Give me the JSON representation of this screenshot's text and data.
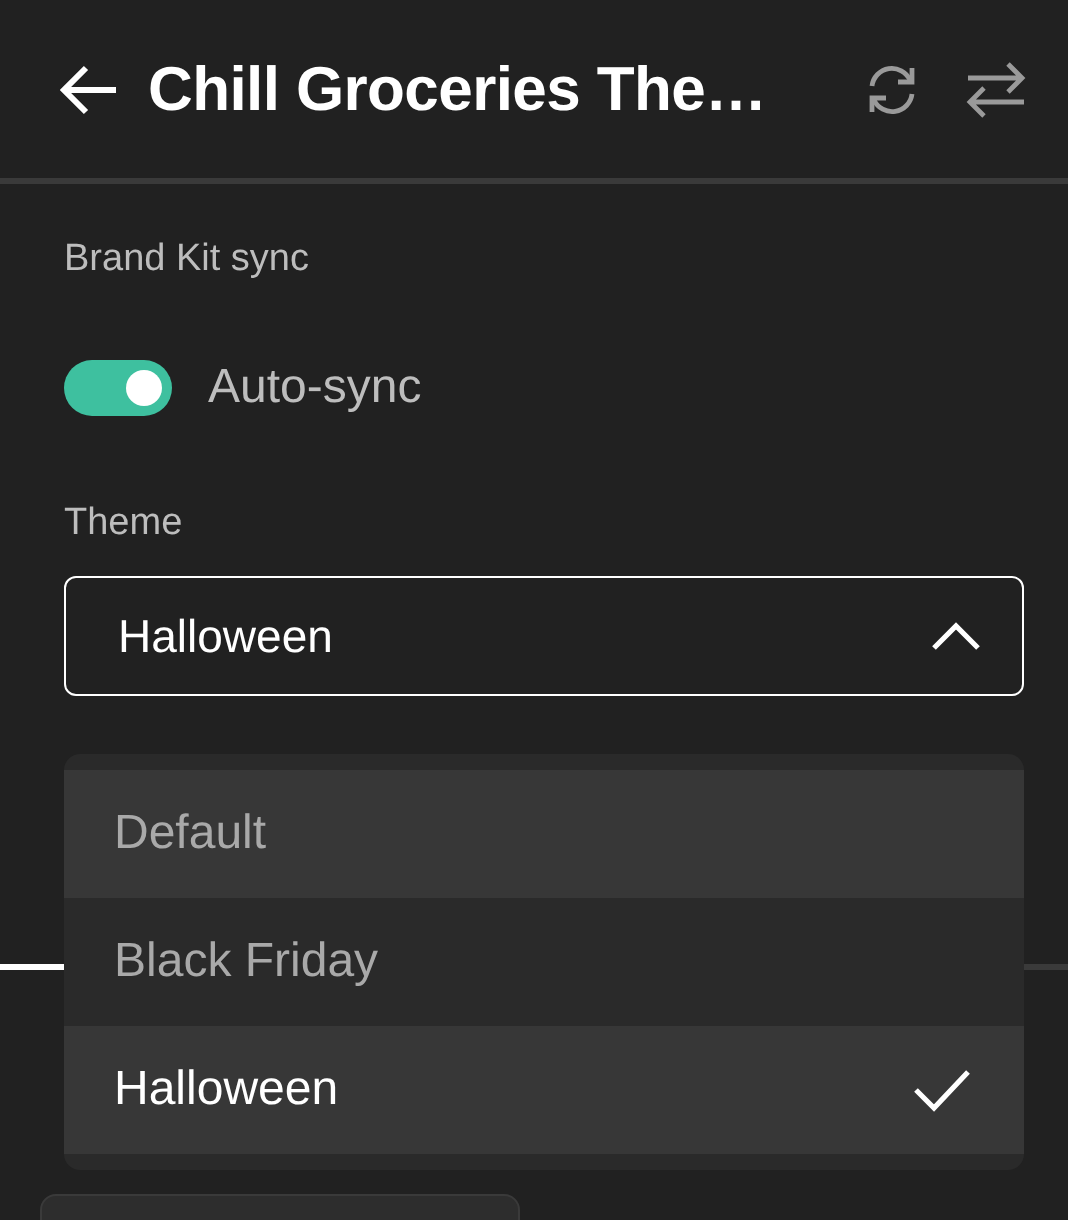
{
  "header": {
    "title": "Chill Groceries The…"
  },
  "brand_kit_sync": {
    "label": "Brand Kit sync",
    "auto_sync": {
      "label": "Auto-sync",
      "on": true
    }
  },
  "theme": {
    "label": "Theme",
    "value": "Halloween",
    "expanded": true,
    "options": [
      {
        "label": "Default",
        "selected": false,
        "hovered": true
      },
      {
        "label": "Black Friday",
        "selected": false,
        "hovered": false
      },
      {
        "label": "Halloween",
        "selected": true,
        "hovered": false
      }
    ]
  }
}
